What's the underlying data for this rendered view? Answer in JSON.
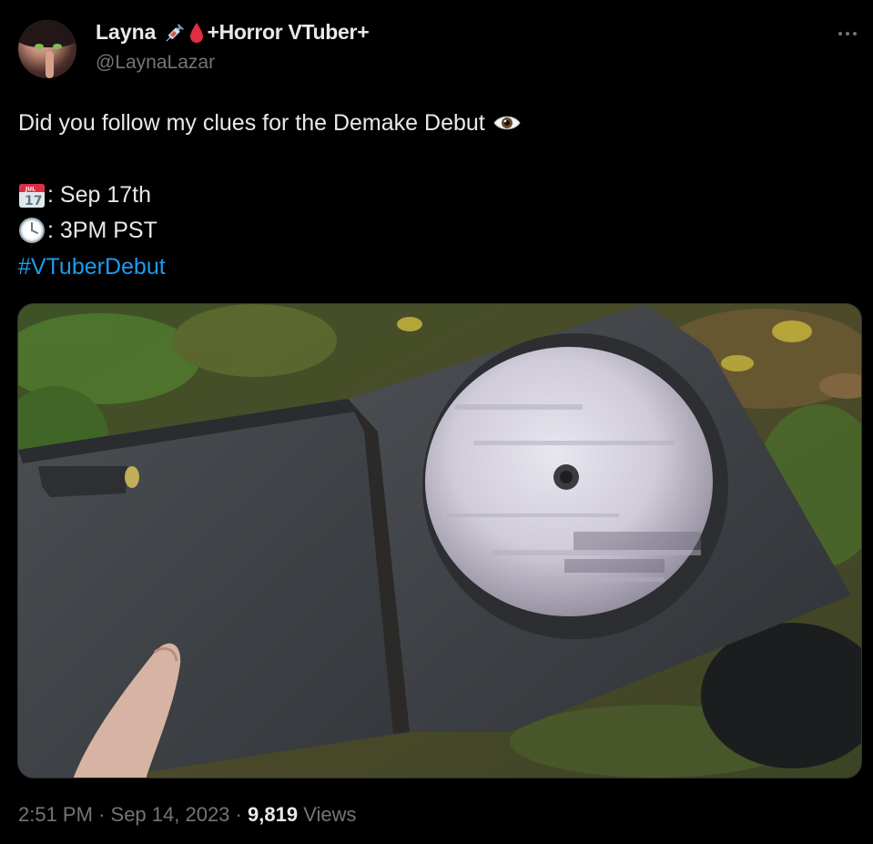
{
  "author": {
    "display_name": "Layna",
    "name_suffix": "+Horror VTuber+",
    "handle": "@LaynaLazar",
    "name_icons": [
      "syringe-icon",
      "blood-drop-icon"
    ]
  },
  "tweet": {
    "line1_text": "Did you follow my clues for the Demake Debut",
    "line1_icon": "eye-icon",
    "date_icon": "calendar-icon",
    "date_icon_month": "JUL",
    "date_icon_day": "17",
    "date_text": ": Sep 17th",
    "time_icon": "clock-icon",
    "time_text": ": 3PM PST",
    "hashtag": "#VTuberDebut"
  },
  "media": {
    "subject": "opened DVD case with glitched disc on leafy ground"
  },
  "meta": {
    "time": "2:51 PM",
    "separator": "·",
    "date": "Sep 14, 2023",
    "views_count": "9,819",
    "views_label": "Views"
  },
  "colors": {
    "background": "#000000",
    "text_primary": "#e7e9ea",
    "text_secondary": "#71767b",
    "link": "#1d9bf0"
  }
}
